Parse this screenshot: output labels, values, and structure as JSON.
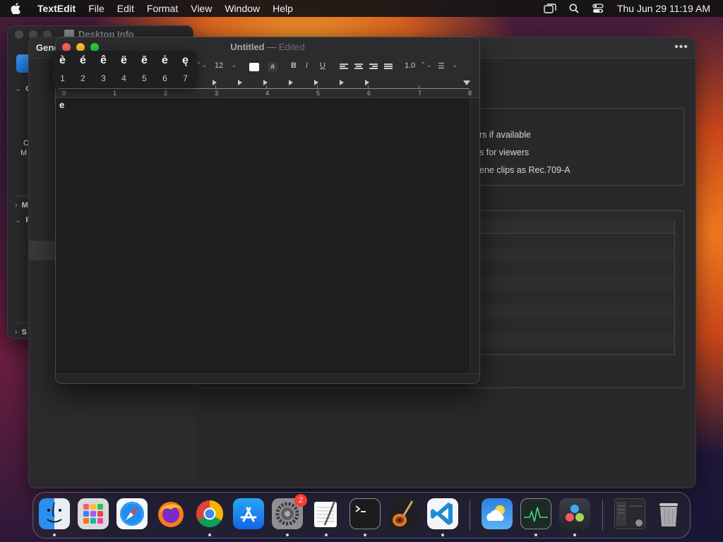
{
  "menubar": {
    "app_name": "TextEdit",
    "menus": [
      "File",
      "Edit",
      "Format",
      "View",
      "Window",
      "Help"
    ],
    "status_icons": [
      "screen-mirroring-icon",
      "search-icon",
      "control-center-icon"
    ],
    "clock": "Thu Jun 29  11:19 AM"
  },
  "info_window": {
    "title": "Desktop Info",
    "sections": [
      "G",
      "M",
      "P",
      "S"
    ],
    "fragments": [
      "C",
      "M"
    ]
  },
  "bg_window": {
    "tab_fragment": "Gene",
    "options": [
      "rs if available",
      "s for viewers",
      "ene clips as Rec.709-A"
    ]
  },
  "textedit": {
    "title": "Untitled",
    "separator": "—",
    "status": "Edited",
    "toolbar": {
      "font_size": "12",
      "bold": "B",
      "italic": "I",
      "underline": "U",
      "line_spacing": "1.0",
      "background_swatch_glyph": "a"
    },
    "ruler_numbers": [
      "0",
      "1",
      "2",
      "3",
      "4",
      "5",
      "6",
      "7",
      "8"
    ],
    "document_text": "e"
  },
  "accent_popup": {
    "options": [
      {
        "char": "è",
        "key": "1"
      },
      {
        "char": "é",
        "key": "2"
      },
      {
        "char": "ê",
        "key": "3"
      },
      {
        "char": "ë",
        "key": "4"
      },
      {
        "char": "ē",
        "key": "5"
      },
      {
        "char": "ė",
        "key": "6"
      },
      {
        "char": "ę",
        "key": "7"
      }
    ]
  },
  "dock": {
    "apps": [
      {
        "name": "Finder",
        "icon": "finder-icon",
        "running": true
      },
      {
        "name": "Launchpad",
        "icon": "launchpad-icon",
        "running": false
      },
      {
        "name": "Safari",
        "icon": "safari-icon",
        "running": false
      },
      {
        "name": "Firefox",
        "icon": "firefox-icon",
        "running": false
      },
      {
        "name": "Chrome",
        "icon": "chrome-icon",
        "running": true
      },
      {
        "name": "App Store",
        "icon": "app-store-icon",
        "running": false
      },
      {
        "name": "System Settings",
        "icon": "system-settings-icon",
        "running": true,
        "badge": "2"
      },
      {
        "name": "TextEdit",
        "icon": "textedit-icon",
        "running": true
      },
      {
        "name": "Terminal",
        "icon": "terminal-icon",
        "running": true
      },
      {
        "name": "GarageBand",
        "icon": "garageband-icon",
        "running": false
      },
      {
        "name": "Visual Studio Code",
        "icon": "vscode-icon",
        "running": true
      },
      {
        "name": "Weather",
        "icon": "weather-icon",
        "running": false
      },
      {
        "name": "Activity Monitor",
        "icon": "activity-monitor-icon",
        "running": true
      },
      {
        "name": "DaVinci Resolve",
        "icon": "davinci-resolve-icon",
        "running": true
      },
      {
        "name": "Recent Window",
        "icon": "window-thumbnail-icon",
        "running": false
      },
      {
        "name": "Trash",
        "icon": "trash-icon",
        "running": false
      }
    ]
  },
  "colors": {
    "close": "#ff5f57",
    "minimize": "#febc2e",
    "maximize": "#28c840",
    "badge": "#ff3b30"
  }
}
